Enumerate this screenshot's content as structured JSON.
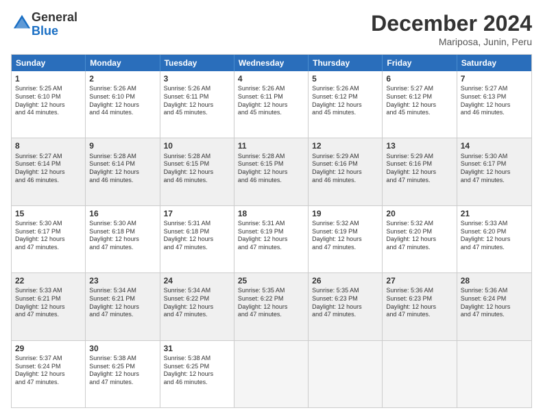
{
  "header": {
    "logo_general": "General",
    "logo_blue": "Blue",
    "month_title": "December 2024",
    "location": "Mariposa, Junin, Peru"
  },
  "weekdays": [
    "Sunday",
    "Monday",
    "Tuesday",
    "Wednesday",
    "Thursday",
    "Friday",
    "Saturday"
  ],
  "rows": [
    [
      {
        "day": "1",
        "lines": [
          "Sunrise: 5:25 AM",
          "Sunset: 6:10 PM",
          "Daylight: 12 hours",
          "and 44 minutes."
        ]
      },
      {
        "day": "2",
        "lines": [
          "Sunrise: 5:26 AM",
          "Sunset: 6:10 PM",
          "Daylight: 12 hours",
          "and 44 minutes."
        ]
      },
      {
        "day": "3",
        "lines": [
          "Sunrise: 5:26 AM",
          "Sunset: 6:11 PM",
          "Daylight: 12 hours",
          "and 45 minutes."
        ]
      },
      {
        "day": "4",
        "lines": [
          "Sunrise: 5:26 AM",
          "Sunset: 6:11 PM",
          "Daylight: 12 hours",
          "and 45 minutes."
        ]
      },
      {
        "day": "5",
        "lines": [
          "Sunrise: 5:26 AM",
          "Sunset: 6:12 PM",
          "Daylight: 12 hours",
          "and 45 minutes."
        ]
      },
      {
        "day": "6",
        "lines": [
          "Sunrise: 5:27 AM",
          "Sunset: 6:12 PM",
          "Daylight: 12 hours",
          "and 45 minutes."
        ]
      },
      {
        "day": "7",
        "lines": [
          "Sunrise: 5:27 AM",
          "Sunset: 6:13 PM",
          "Daylight: 12 hours",
          "and 46 minutes."
        ]
      }
    ],
    [
      {
        "day": "8",
        "lines": [
          "Sunrise: 5:27 AM",
          "Sunset: 6:14 PM",
          "Daylight: 12 hours",
          "and 46 minutes."
        ]
      },
      {
        "day": "9",
        "lines": [
          "Sunrise: 5:28 AM",
          "Sunset: 6:14 PM",
          "Daylight: 12 hours",
          "and 46 minutes."
        ]
      },
      {
        "day": "10",
        "lines": [
          "Sunrise: 5:28 AM",
          "Sunset: 6:15 PM",
          "Daylight: 12 hours",
          "and 46 minutes."
        ]
      },
      {
        "day": "11",
        "lines": [
          "Sunrise: 5:28 AM",
          "Sunset: 6:15 PM",
          "Daylight: 12 hours",
          "and 46 minutes."
        ]
      },
      {
        "day": "12",
        "lines": [
          "Sunrise: 5:29 AM",
          "Sunset: 6:16 PM",
          "Daylight: 12 hours",
          "and 46 minutes."
        ]
      },
      {
        "day": "13",
        "lines": [
          "Sunrise: 5:29 AM",
          "Sunset: 6:16 PM",
          "Daylight: 12 hours",
          "and 47 minutes."
        ]
      },
      {
        "day": "14",
        "lines": [
          "Sunrise: 5:30 AM",
          "Sunset: 6:17 PM",
          "Daylight: 12 hours",
          "and 47 minutes."
        ]
      }
    ],
    [
      {
        "day": "15",
        "lines": [
          "Sunrise: 5:30 AM",
          "Sunset: 6:17 PM",
          "Daylight: 12 hours",
          "and 47 minutes."
        ]
      },
      {
        "day": "16",
        "lines": [
          "Sunrise: 5:30 AM",
          "Sunset: 6:18 PM",
          "Daylight: 12 hours",
          "and 47 minutes."
        ]
      },
      {
        "day": "17",
        "lines": [
          "Sunrise: 5:31 AM",
          "Sunset: 6:18 PM",
          "Daylight: 12 hours",
          "and 47 minutes."
        ]
      },
      {
        "day": "18",
        "lines": [
          "Sunrise: 5:31 AM",
          "Sunset: 6:19 PM",
          "Daylight: 12 hours",
          "and 47 minutes."
        ]
      },
      {
        "day": "19",
        "lines": [
          "Sunrise: 5:32 AM",
          "Sunset: 6:19 PM",
          "Daylight: 12 hours",
          "and 47 minutes."
        ]
      },
      {
        "day": "20",
        "lines": [
          "Sunrise: 5:32 AM",
          "Sunset: 6:20 PM",
          "Daylight: 12 hours",
          "and 47 minutes."
        ]
      },
      {
        "day": "21",
        "lines": [
          "Sunrise: 5:33 AM",
          "Sunset: 6:20 PM",
          "Daylight: 12 hours",
          "and 47 minutes."
        ]
      }
    ],
    [
      {
        "day": "22",
        "lines": [
          "Sunrise: 5:33 AM",
          "Sunset: 6:21 PM",
          "Daylight: 12 hours",
          "and 47 minutes."
        ]
      },
      {
        "day": "23",
        "lines": [
          "Sunrise: 5:34 AM",
          "Sunset: 6:21 PM",
          "Daylight: 12 hours",
          "and 47 minutes."
        ]
      },
      {
        "day": "24",
        "lines": [
          "Sunrise: 5:34 AM",
          "Sunset: 6:22 PM",
          "Daylight: 12 hours",
          "and 47 minutes."
        ]
      },
      {
        "day": "25",
        "lines": [
          "Sunrise: 5:35 AM",
          "Sunset: 6:22 PM",
          "Daylight: 12 hours",
          "and 47 minutes."
        ]
      },
      {
        "day": "26",
        "lines": [
          "Sunrise: 5:35 AM",
          "Sunset: 6:23 PM",
          "Daylight: 12 hours",
          "and 47 minutes."
        ]
      },
      {
        "day": "27",
        "lines": [
          "Sunrise: 5:36 AM",
          "Sunset: 6:23 PM",
          "Daylight: 12 hours",
          "and 47 minutes."
        ]
      },
      {
        "day": "28",
        "lines": [
          "Sunrise: 5:36 AM",
          "Sunset: 6:24 PM",
          "Daylight: 12 hours",
          "and 47 minutes."
        ]
      }
    ],
    [
      {
        "day": "29",
        "lines": [
          "Sunrise: 5:37 AM",
          "Sunset: 6:24 PM",
          "Daylight: 12 hours",
          "and 47 minutes."
        ]
      },
      {
        "day": "30",
        "lines": [
          "Sunrise: 5:38 AM",
          "Sunset: 6:25 PM",
          "Daylight: 12 hours",
          "and 47 minutes."
        ]
      },
      {
        "day": "31",
        "lines": [
          "Sunrise: 5:38 AM",
          "Sunset: 6:25 PM",
          "Daylight: 12 hours",
          "and 46 minutes."
        ]
      },
      null,
      null,
      null,
      null
    ]
  ]
}
